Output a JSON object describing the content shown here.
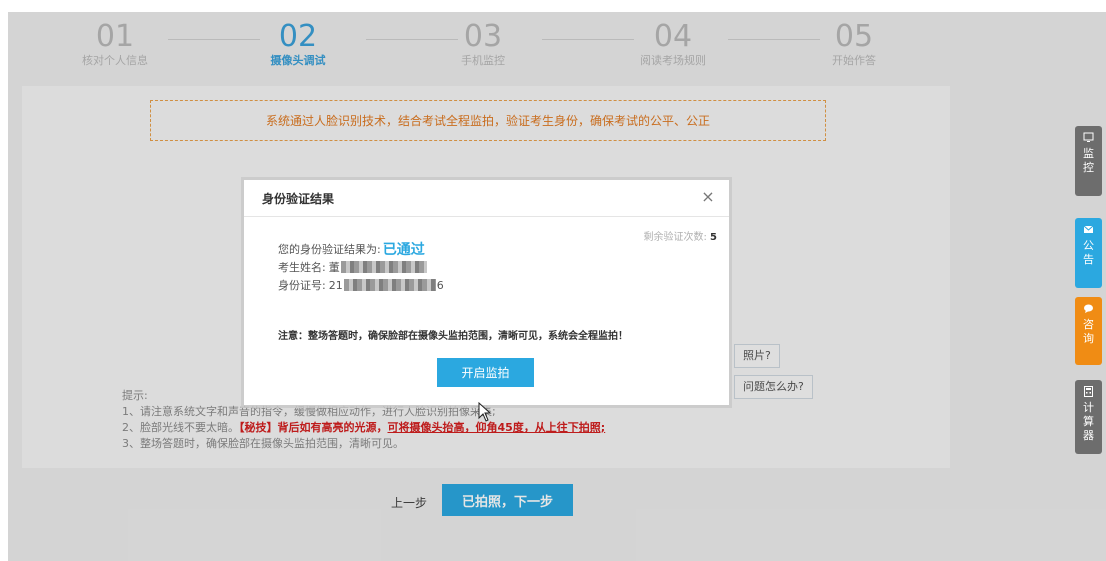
{
  "steps": [
    {
      "num": "01",
      "label": "核对个人信息"
    },
    {
      "num": "02",
      "label": "摄像头调试"
    },
    {
      "num": "03",
      "label": "手机监控"
    },
    {
      "num": "04",
      "label": "阅读考场规则"
    },
    {
      "num": "05",
      "label": "开始作答"
    }
  ],
  "notice": "系统通过人脸识别技术，结合考试全程监拍，验证考生身份，确保考试的公平、公正",
  "help_buttons": [
    "照片?",
    "问题怎么办?"
  ],
  "tips": {
    "title": "提示:",
    "line1": "1、请注意系统文字和声音的指令，缓慢做相应动作，进行人脸识别拍像采集;",
    "line2_prefix": "2、脸部光线不要太暗。",
    "line2_red": "【秘技】背后如有高亮的光源，",
    "line2_red_u": "可将摄像头抬高，仰角45度，从上往下拍照;",
    "line3": "3、整场答题时，确保脸部在摄像头监拍范围，清晰可见。"
  },
  "nav": {
    "prev": "上一步",
    "next": "已拍照，下一步"
  },
  "modal": {
    "title": "身份验证结果",
    "close": "×",
    "remain_label": "剩余验证次数:",
    "remain_value": "5",
    "result_label": "您的身份验证结果为:",
    "result_value": "已通过",
    "name_label": "考生姓名:",
    "name_prefix": "董",
    "id_label": "身份证号:",
    "id_prefix": "21",
    "id_suffix": "6",
    "warning": "注意：整场答题时，确保脸部在摄像头监拍范围，清晰可见，系统会全程监拍！",
    "start_button": "开启监拍"
  },
  "side": [
    {
      "label": "监控",
      "icon": "monitor-icon",
      "color": "#6d6d6d"
    },
    {
      "label": "公告",
      "icon": "mail-icon",
      "color": "#2ba8e0"
    },
    {
      "label": "咨询",
      "icon": "chat-icon",
      "color": "#f08c14"
    },
    {
      "label": "计算器",
      "icon": "calculator-icon",
      "color": "#6d6d6d"
    }
  ]
}
